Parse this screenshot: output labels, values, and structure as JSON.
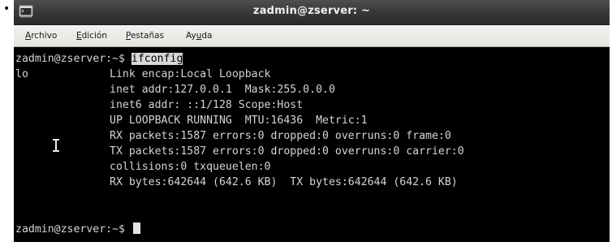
{
  "window": {
    "title": "zadmin@zserver: ~"
  },
  "menubar": {
    "items": [
      {
        "mnemonic": "A",
        "rest": "rchivo"
      },
      {
        "mnemonic": "E",
        "rest": "dición"
      },
      {
        "mnemonic": "P",
        "rest": "estañas"
      },
      {
        "pre": "Ay",
        "mnemonic": "u",
        "rest": "da"
      }
    ]
  },
  "terminal": {
    "prompt": "zadmin@zserver:~$ ",
    "command": "ifconfig",
    "interface": "lo",
    "output": [
      "Link encap:Local Loopback",
      "inet addr:127.0.0.1  Mask:255.0.0.0",
      "inet6 addr: ::1/128 Scope:Host",
      "UP LOOPBACK RUNNING  MTU:16436  Metric:1",
      "RX packets:1587 errors:0 dropped:0 overruns:0 frame:0",
      "TX packets:1587 errors:0 dropped:0 overruns:0 carrier:0",
      "collisions:0 txqueuelen:0",
      "RX bytes:642644 (642.6 KB)  TX bytes:642644 (642.6 KB)"
    ],
    "final_prompt": "zadmin@zserver:~$ "
  },
  "colors": {
    "terminal_bg": "#000000",
    "terminal_fg": "#d4d4d4",
    "titlebar": "#3a3a3a",
    "menubar": "#e8e6e2"
  },
  "icons": {
    "window_icon": "terminal-icon",
    "pointer": "text-cursor-ibeam-icon"
  }
}
